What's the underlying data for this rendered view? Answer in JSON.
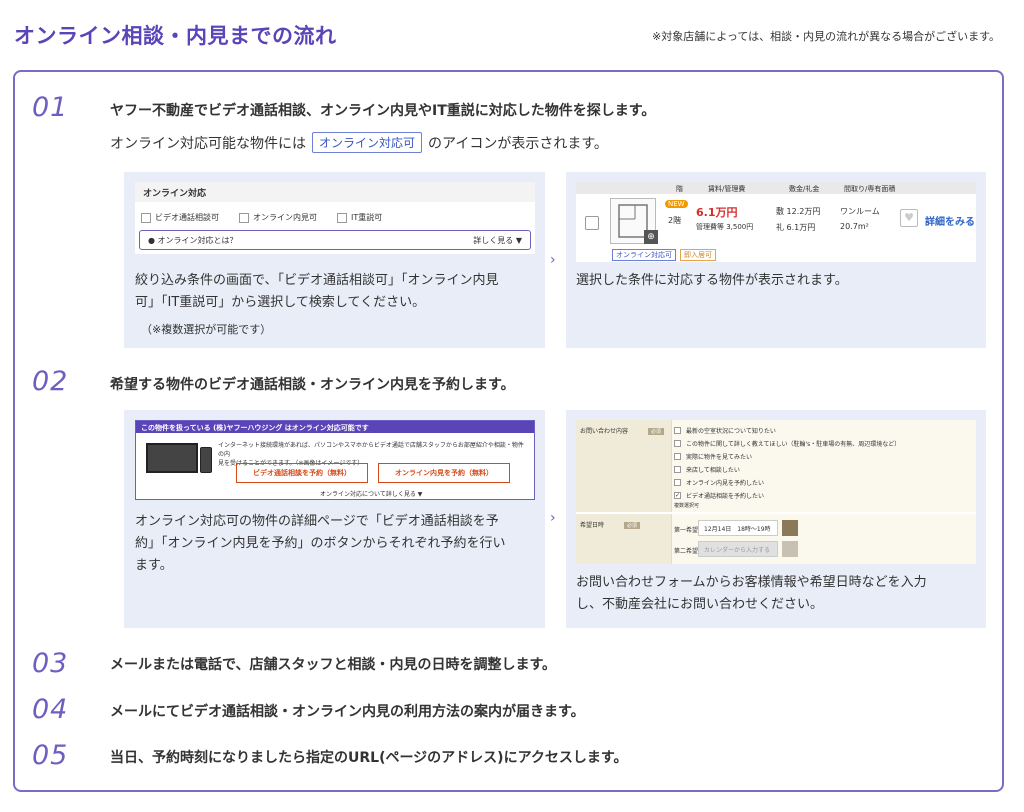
{
  "header": {
    "title": "オンライン相談・内見までの流れ",
    "note": "※対象店舗によっては、相談・内見の流れが異なる場合がございます。"
  },
  "steps": [
    {
      "num": "01",
      "text": "ヤフー不動産でビデオ通話相談、オンライン内見やIT重説に対応した物件を探します。"
    },
    {
      "num": "02",
      "text": "希望する物件のビデオ通話相談・オンライン内見を予約します。"
    },
    {
      "num": "03",
      "text": "メールまたは電話で、店舗スタッフと相談・内見の日時を調整します。"
    },
    {
      "num": "04",
      "text": "メールにてビデオ通話相談・オンライン内見の利用方法の案内が届きます。"
    },
    {
      "num": "05",
      "text": "当日、予約時刻になりましたら指定のURL(ページのアドレス)にアクセスします。"
    }
  ],
  "step1": {
    "sub_before": "オンライン対応可能な物件には",
    "badge": "オンライン対応可",
    "sub_after": "のアイコンが表示されます。",
    "panel_left": {
      "line1": "絞り込み条件の画面で、「ビデオ通話相談可」「オンライン内見",
      "line2": "可」「IT重説可」から選択して検索してください。",
      "note": "（※複数選択が可能です）"
    },
    "panel_right": "選択した条件に対応する物件が表示されます。",
    "mock_filter": {
      "heading": "オンライン対応",
      "options": [
        "ビデオ通話相談可",
        "オンライン内見可",
        "IT重説可"
      ],
      "what": "オンライン対応とは？",
      "more": "詳しく見る ▼"
    },
    "mock_listing": {
      "headers": [
        "階",
        "賃料/管理費",
        "敷金/礼金",
        "間取り/専有面積"
      ],
      "new": "NEW",
      "floor": "2階",
      "price": "6.1万円",
      "fee": "管理費等 3,500円",
      "deposit": "敷 12.2万円",
      "key_money": "礼 6.1万円",
      "layout": "ワンルーム",
      "area": "20.7m²",
      "detail": "詳細をみる",
      "tag_online": "オンライン対応可",
      "tag_other": "即入居可"
    }
  },
  "step2": {
    "panel_left": {
      "line1": "オンライン対応可の物件の詳細ページで「ビデオ通話相談を予",
      "line2": "約」「オンライン内見を予約」のボタンからそれぞれ予約を行い",
      "line3": "ます。"
    },
    "panel_right": {
      "line1": "お問い合わせフォームからお客様情報や希望日時などを入力",
      "line2": "し、不動産会社にお問い合わせください。"
    },
    "mock_detail": {
      "bar": "この物件を扱っている (株)ヤフーハウジング はオンライン対応可能です",
      "desc1": "インターネット接続環境があれば、パソコンやスマホからビデオ通話で店舗スタッフからお部屋紹介や相談・物件の内",
      "desc2": "見を受けることができます。（※画像はイメージです）",
      "btn_video": "ビデオ通話相談を予約（無料）",
      "btn_online": "オンライン内見を予約（無料）",
      "more": "オンライン対応について詳しく見る ▼"
    },
    "mock_form": {
      "label_inquiry": "お問い合わせ内容",
      "label_date": "希望日時",
      "required": "必須",
      "checks": [
        "最新の空室状況について知りたい",
        "この物件に関して詳しく教えてほしい（駐輪's・駐車場の有無、周辺環境など）",
        "実際に物件を見てみたい",
        "来店して相談したい",
        "オンライン内見を予約したい",
        "ビデオ通話相談を予約したい"
      ],
      "multi": "複数選択可",
      "first": "第一希望",
      "first_value": "12月14日　18時〜19時",
      "second": "第二希望",
      "second_value": "カレンダーから入力する"
    }
  },
  "colors": {
    "accent": "#5b43b8",
    "panel_bg": "#e8edf8",
    "link": "#2e64c8",
    "price": "#d62c2c"
  }
}
